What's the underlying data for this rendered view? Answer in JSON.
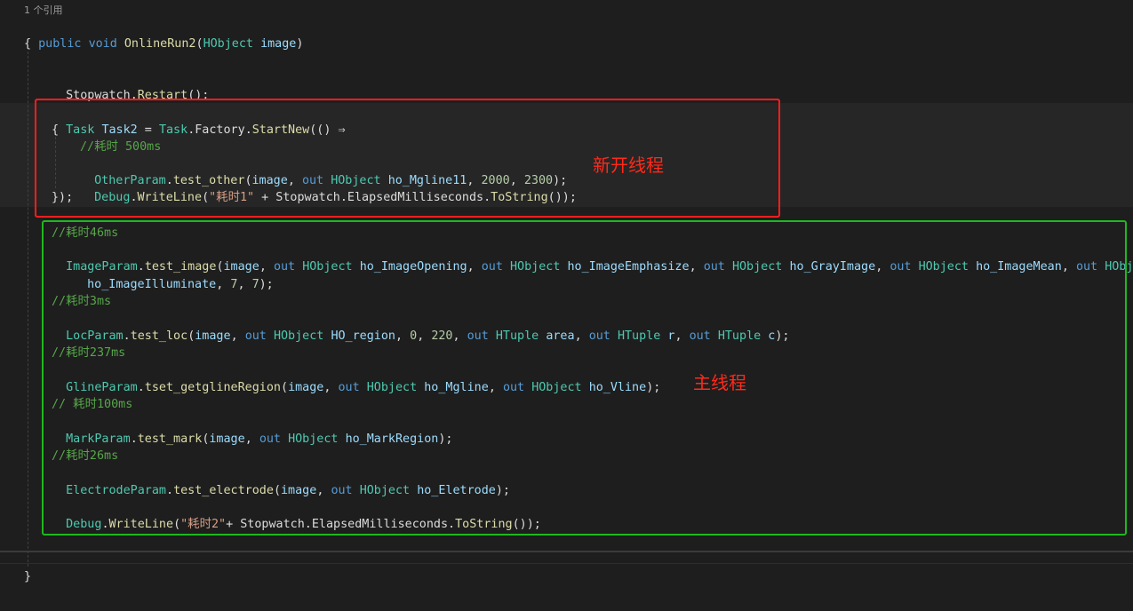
{
  "codelens": {
    "references": "1 个引用"
  },
  "lines": {
    "sig": {
      "kw1": "public",
      "kw2": "void",
      "name": "OnlineRun2",
      "open": "(",
      "type": "HObject",
      "param": "image",
      "close": ")"
    },
    "brace_open": "{",
    "restart": {
      "cls": "Stopwatch",
      "dot": ".",
      "method": "Restart",
      "rest": "();"
    },
    "task": {
      "t1": "Task",
      "v": "Task2",
      "eq": " = ",
      "t2": "Task",
      "d1": ".",
      "factory": "Factory",
      "d2": ".",
      "method": "StartNew",
      "rest": "(() ⇒"
    },
    "task_brace_open": "{",
    "c_500": "//耗时 500ms",
    "other": {
      "cls": "OtherParam",
      "dot": ".",
      "method": "test_other",
      "p1": "(",
      "a1": "image",
      "c1": ", ",
      "out": "out",
      "sp": " ",
      "type": "HObject",
      "sp2": " ",
      "v1": "ho_Mgline11",
      "c2": ", ",
      "n1": "2000",
      "c3": ", ",
      "n2": "2300",
      "rest": ");"
    },
    "dbg1": {
      "cls": "Debug",
      "dot": ".",
      "method": "WriteLine",
      "p1": "(",
      "str": "\"耗时1\"",
      "plus": " + ",
      "sw": "Stopwatch",
      "d2": ".",
      "prop": "ElapsedMilliseconds",
      "d3": ".",
      "ts": "ToString",
      "rest": "());"
    },
    "task_close": "});",
    "c_46": "//耗时46ms",
    "image": {
      "cls": "ImageParam",
      "dot": ".",
      "method": "test_image",
      "p1": "(",
      "a1": "image",
      "c1": ", ",
      "out1": "out",
      "t1": "HObject",
      "v1": "ho_ImageOpening",
      "c2": ", ",
      "out2": "out",
      "t2": "HObject",
      "v2": "ho_ImageEmphasize",
      "c3": ", ",
      "out3": "out",
      "t3": "HObject",
      "v3": "ho_GrayImage",
      "c4": ", ",
      "out4": "out",
      "t4": "HObject",
      "v4": "ho_ImageMean",
      "c5": ", ",
      "out5": "out",
      "t5": "HObject",
      "tail": " ho_ImageIllum"
    },
    "image_cont": {
      "v": "ho_ImageIlluminate",
      "rest1": ", ",
      "n1": "7",
      "c": ", ",
      "n2": "7",
      "rest": ");"
    },
    "c_3": "//耗时3ms",
    "loc": {
      "cls": "LocParam",
      "dot": ".",
      "method": "test_loc",
      "p1": "(",
      "a1": "image",
      "c1": ", ",
      "out1": "out",
      "t1": "HObject",
      "v1": "HO_region",
      "c2": ", ",
      "n1": "0",
      "c3": ", ",
      "n2": "220",
      "c4": ", ",
      "out2": "out",
      "t2": "HTuple",
      "v2": "area",
      "c5": ", ",
      "out3": "out",
      "t3": "HTuple",
      "v3": "r",
      "c6": ", ",
      "out4": "out",
      "t4": "HTuple",
      "v4": "c",
      "rest": ");"
    },
    "c_237": "//耗时237ms",
    "gline": {
      "cls": "GlineParam",
      "dot": ".",
      "method": "tset_getglineRegion",
      "p1": "(",
      "a1": "image",
      "c1": ", ",
      "out1": "out",
      "t1": "HObject",
      "v1": "ho_Mgline",
      "c2": ", ",
      "out2": "out",
      "t2": "HObject",
      "v2": "ho_Vline",
      "rest": ");"
    },
    "c_100": "// 耗时100ms",
    "mark": {
      "cls": "MarkParam",
      "dot": ".",
      "method": "test_mark",
      "p1": "(",
      "a1": "image",
      "c1": ", ",
      "out1": "out",
      "t1": "HObject",
      "v1": "ho_MarkRegion",
      "rest": ");"
    },
    "c_26": "//耗时26ms",
    "electrode": {
      "cls": "ElectrodeParam",
      "dot": ".",
      "method": "test_electrode",
      "p1": "(",
      "a1": "image",
      "c1": ", ",
      "out1": "out",
      "t1": "HObject",
      "v1": "ho_Eletrode",
      "rest": ");"
    },
    "dbg2": {
      "cls": "Debug",
      "dot": ".",
      "method": "WriteLine",
      "p1": "(",
      "str": "\"耗时2\"",
      "plus": "+ ",
      "sw": "Stopwatch",
      "d2": ".",
      "prop": "ElapsedMilliseconds",
      "d3": ".",
      "ts": "ToString",
      "rest": "());"
    },
    "brace_close": "}"
  },
  "annotations": {
    "new_thread": "新开线程",
    "main_thread": "主线程",
    "red": "#ff1e1e",
    "green": "#1fb81f"
  },
  "theme": {
    "background": "#1e1e1e",
    "keyword": "#569cd6",
    "type": "#4ec9b0",
    "method": "#dcdcaa",
    "variable": "#9cdcfe",
    "number": "#b5cea8",
    "string": "#d69d85",
    "comment": "#57a64a"
  }
}
